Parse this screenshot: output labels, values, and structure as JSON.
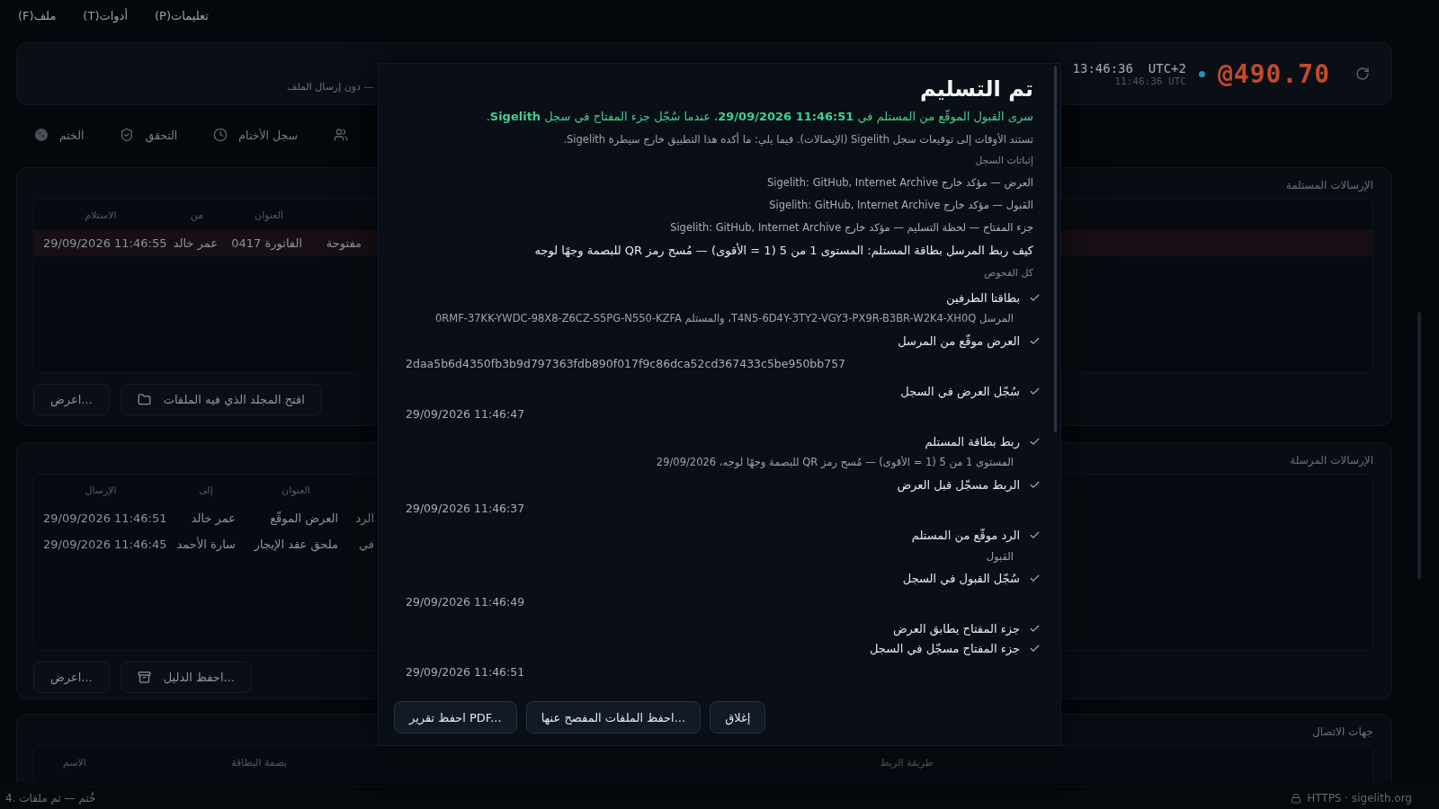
{
  "menu": [
    {
      "label": "تعليمات(P)"
    },
    {
      "label": "أدوات(T)"
    },
    {
      "label": "ملف(F)"
    }
  ],
  "header": {
    "subtitle": "— دون إرسال الملف",
    "clock": {
      "local": "13:46:36",
      "zone": "UTC+2",
      "utc": "11:46:36 UTC"
    },
    "online": true,
    "balance": "@490.70"
  },
  "tabs": [
    {
      "kind": "contacts"
    },
    {
      "kind": "history",
      "label": "سجل الأختام"
    },
    {
      "kind": "verify",
      "label": "التحقق"
    },
    {
      "kind": "seal",
      "label": "الختم"
    }
  ],
  "received": {
    "title": "الإرسالات المستلمة",
    "columns": {
      "subject": "العنوان",
      "party": "من",
      "time": "الاستلام"
    },
    "rows": [
      {
        "status": "مفتوحة",
        "subject": "الفاتورة 0417",
        "party": "عمر خالد",
        "time": "29/09/2026 11:46:55",
        "selected": true
      }
    ],
    "actions": [
      {
        "label": "افتح المجلد الذي فيه الملفات",
        "kind": "folder"
      },
      {
        "label": "اعرض...",
        "kind": "plain"
      }
    ]
  },
  "sent": {
    "title": "الإرسالات المرسلة",
    "columns": {
      "subject": "العنوان",
      "party": "إلى",
      "time": "الإرسال"
    },
    "rows": [
      {
        "status": "الرد",
        "subject": "العرض الموقّع",
        "party": "عمر خالد",
        "time": "29/09/2026 11:46:51",
        "selected": false
      },
      {
        "status": "في",
        "subject": "ملحق عقد الإيجار",
        "party": "سارة الأحمد",
        "time": "29/09/2026 11:46:45",
        "selected": false
      }
    ],
    "actions": [
      {
        "label": "احفظ الدليل...",
        "kind": "archive"
      },
      {
        "label": "اعرض...",
        "kind": "plain"
      }
    ]
  },
  "contacts": {
    "title": "جهات الاتصال",
    "columns": {
      "name": "الاسم",
      "fingerprint": "بصمة البطاقة",
      "method": "طريقة الربط"
    }
  },
  "dialog": {
    "title": "تم التسليم",
    "summary": "سرى القبول الموقّع من المستلم في **29/09/2026 11:46:51**، عندما سُجّل جزء المفتاح في سجل **Sigelith**.",
    "note": "تستند الأوقات إلى توقيعات سجل Sigelith (الإيصالات). فيما يلي: ما أكده هذا التطبيق خارج سيطرة Sigelith.",
    "proofs_label": "إثباتات السجل",
    "proofs": [
      "العرض — مؤكد خارج Sigelith: GitHub, Internet Archive",
      "القبول — مؤكد خارج Sigelith: GitHub, Internet Archive",
      "جزء المفتاح — لحظة التسليم — مؤكد خارج Sigelith: GitHub, Internet Archive"
    ],
    "binding": "كيف ربط المرسل بطاقة المستلم: المستوى 1 من 5 (1 = الأقوى) — مُسح رمز QR للبصمة وجهًا لوجه",
    "checks_label": "كل الفحوص",
    "checks": [
      {
        "label": "بطاقتا الطرفين",
        "passed": true,
        "detail": {
          "kind": "note",
          "text": "المرسل T4N5-6D4Y-3TY2-VGY3-PX9R-B3BR-W2K4-XH0Q، والمستلم 0RMF-37KK-YWDC-98X8-Z6CZ-S5PG-N550-KZFA"
        }
      },
      {
        "label": "العرض موقّع من المرسل",
        "passed": true,
        "detail": {
          "kind": "value",
          "text": "2daa5b6d4350fb3b9d797363fdb890f017f9c86dca52cd367433c5be950bb757"
        }
      },
      {
        "label": "سُجّل العرض في السجل",
        "passed": true,
        "detail": {
          "kind": "value",
          "text": "29/09/2026 11:46:47"
        }
      },
      {
        "label": "ربط بطاقة المستلم",
        "passed": true,
        "detail": {
          "kind": "note",
          "text": "المستوى 1 من 5 (1 = الأقوى) — مُسح رمز QR للبصمة وجهًا لوجه، 29/09/2026"
        }
      },
      {
        "label": "الربط مسجّل قبل العرض",
        "passed": true,
        "detail": {
          "kind": "value",
          "text": "29/09/2026 11:46:37"
        }
      },
      {
        "label": "الرد موقّع من المستلم",
        "passed": true,
        "detail": {
          "kind": "note",
          "text": "القبول"
        }
      },
      {
        "label": "سُجّل القبول في السجل",
        "passed": true,
        "detail": {
          "kind": "value",
          "text": "29/09/2026 11:46:49"
        }
      },
      {
        "label": "جزء المفتاح يطابق العرض",
        "passed": true
      },
      {
        "label": "جزء المفتاح مسجّل في السجل",
        "passed": true,
        "detail": {
          "kind": "value",
          "text": "29/09/2026 11:46:51"
        }
      }
    ],
    "buttons": [
      "إغلاق",
      "احفظ الملفات المفصح عنها...",
      "احفظ تقرير PDF..."
    ]
  },
  "status_bar": {
    "message": "4. خُتم — تم ملفات",
    "connection": "HTTPS · sigelith.org"
  }
}
